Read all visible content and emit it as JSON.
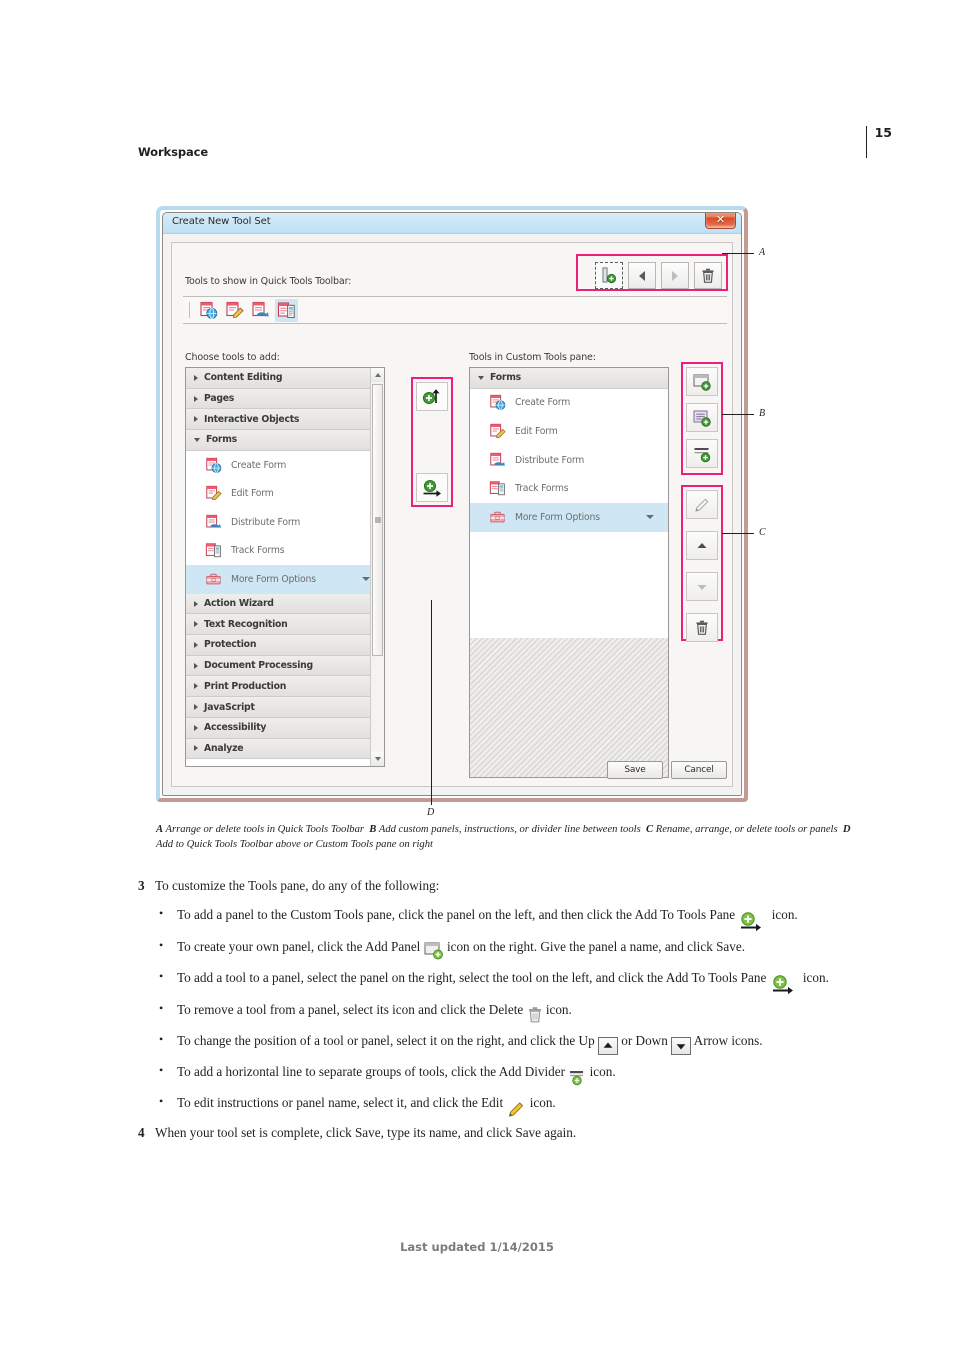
{
  "page": {
    "running_head": "Workspace",
    "page_number": "15",
    "footer": "Last updated 1/14/2015"
  },
  "dialog": {
    "title": "Create New Tool Set",
    "close_icon": "close-icon",
    "quick_tools_label": "Tools to show in Quick Tools Toolbar:",
    "quick_tools_buttons": [
      {
        "name": "add-divider-button",
        "icon": "add-divider-icon",
        "state": "active"
      },
      {
        "name": "move-left-button",
        "icon": "arrow-left-icon",
        "state": "enabled"
      },
      {
        "name": "move-right-button",
        "icon": "arrow-right-icon",
        "state": "disabled"
      },
      {
        "name": "delete-button",
        "icon": "trash-icon",
        "state": "enabled"
      }
    ],
    "quick_tools_icons": [
      {
        "name": "create-form-icon",
        "selected": false
      },
      {
        "name": "edit-form-icon",
        "selected": false
      },
      {
        "name": "distribute-form-icon",
        "selected": false
      },
      {
        "name": "track-forms-icon",
        "selected": true
      }
    ],
    "left_column": {
      "label": "Choose tools to add:",
      "groups": [
        {
          "label": "Content Editing",
          "expanded": false
        },
        {
          "label": "Pages",
          "expanded": false
        },
        {
          "label": "Interactive Objects",
          "expanded": false
        },
        {
          "label": "Forms",
          "expanded": true,
          "tools": [
            {
              "label": "Create Form",
              "icon": "create-form-icon",
              "selected": false,
              "has_menu": false
            },
            {
              "label": "Edit Form",
              "icon": "edit-form-icon",
              "selected": false,
              "has_menu": false
            },
            {
              "label": "Distribute Form",
              "icon": "distribute-form-icon",
              "selected": false,
              "has_menu": false
            },
            {
              "label": "Track Forms",
              "icon": "track-forms-icon",
              "selected": false,
              "has_menu": false
            },
            {
              "label": "More Form Options",
              "icon": "more-form-options-icon",
              "selected": true,
              "has_menu": true
            }
          ]
        },
        {
          "label": "Action Wizard",
          "expanded": false
        },
        {
          "label": "Text Recognition",
          "expanded": false
        },
        {
          "label": "Protection",
          "expanded": false
        },
        {
          "label": "Document Processing",
          "expanded": false
        },
        {
          "label": "Print Production",
          "expanded": false
        },
        {
          "label": "JavaScript",
          "expanded": false
        },
        {
          "label": "Accessibility",
          "expanded": false
        },
        {
          "label": "Analyze",
          "expanded": false
        }
      ]
    },
    "middle_buttons": [
      {
        "name": "add-to-quick-tools-toolbar-button",
        "icon": "plus-up-arrow-icon"
      },
      {
        "name": "add-to-tools-pane-button",
        "icon": "plus-right-arrow-icon"
      }
    ],
    "right_column": {
      "label": "Tools in Custom Tools pane:",
      "groups": [
        {
          "label": "Forms",
          "expanded": true,
          "tools": [
            {
              "label": "Create Form",
              "icon": "create-form-icon",
              "selected": false,
              "has_menu": false
            },
            {
              "label": "Edit Form",
              "icon": "edit-form-icon",
              "selected": false,
              "has_menu": false
            },
            {
              "label": "Distribute Form",
              "icon": "distribute-form-icon",
              "selected": false,
              "has_menu": false
            },
            {
              "label": "Track Forms",
              "icon": "track-forms-icon",
              "selected": false,
              "has_menu": false
            },
            {
              "label": "More Form Options",
              "icon": "more-form-options-icon",
              "selected": true,
              "has_menu": true
            }
          ]
        }
      ]
    },
    "right_buttons_group_b": [
      {
        "name": "add-panel-button",
        "icon": "add-panel-icon"
      },
      {
        "name": "add-instructions-button",
        "icon": "add-instructions-icon"
      },
      {
        "name": "add-divider-button",
        "icon": "add-divider-icon"
      }
    ],
    "right_buttons_group_c": [
      {
        "name": "edit-button",
        "icon": "pencil-icon"
      },
      {
        "name": "move-up-button",
        "icon": "arrow-up-icon"
      },
      {
        "name": "move-down-button",
        "icon": "arrow-down-icon"
      },
      {
        "name": "delete-button",
        "icon": "trash-icon"
      }
    ],
    "footer_buttons": [
      {
        "name": "save-button",
        "label": "Save"
      },
      {
        "name": "cancel-button",
        "label": "Cancel"
      }
    ]
  },
  "callouts": {
    "a": "A",
    "b": "B",
    "c": "C",
    "d": "D"
  },
  "caption": {
    "a_key": "A",
    "a_text": "Arrange or delete tools in Quick Tools Toolbar",
    "b_key": "B",
    "b_text": "Add custom panels, instructions, or divider line between tools",
    "c_key": "C",
    "c_text": "Rename, arrange, or delete tools or panels",
    "d_key": "D",
    "d_text": "Add to Quick Tools Toolbar above or Custom Tools pane on right"
  },
  "steps": {
    "step3_num": "3",
    "step3_text": "To customize the Tools pane, do any of the following:",
    "bullets": [
      {
        "before": "To add a panel to the Custom Tools pane, click the panel on the left, and then click the Add To Tools Pane",
        "icon": "add-to-tools-pane-icon",
        "after": "icon."
      },
      {
        "before": "To create your own panel, click the Add Panel",
        "icon": "add-panel-icon",
        "after": "icon on the right. Give the panel a name, and click Save."
      },
      {
        "before": "To add a tool to a panel, select the panel on the right, select the tool on the left, and click the Add To Tools Pane",
        "icon": "add-to-tools-pane-icon",
        "after": "icon."
      },
      {
        "before": "To remove a tool from a panel, select its icon and click the Delete",
        "icon": "trash-icon",
        "after": "icon."
      },
      {
        "before": "To change the position of a tool or panel, select it on the right, and click the Up",
        "icon": "arrow-up-button-icon",
        "middle": "or Down",
        "icon2": "arrow-down-button-icon",
        "after": "Arrow icons."
      },
      {
        "before": "To add a horizontal line to separate groups of tools, click the Add Divider",
        "icon": "add-divider-icon",
        "after": "icon."
      },
      {
        "before": "To edit instructions or panel name, select it, and click the Edit",
        "icon": "pencil-icon",
        "after": "icon."
      }
    ],
    "step4_num": "4",
    "step4_text": "When your tool set is complete, click Save, type its name, and click Save again."
  },
  "colors": {
    "highlight_pink": "#ec1f7a",
    "selection_blue": "#cfe7f5",
    "title_blue": "#cbe6f7",
    "close_red": "#d9492b",
    "plus_green": "#3f9c35"
  }
}
